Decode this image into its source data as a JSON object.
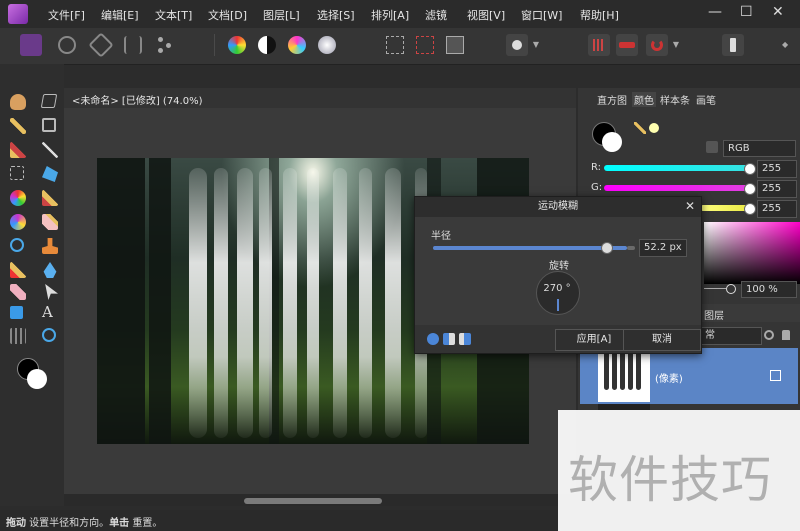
{
  "menu": {
    "items": [
      "文件[F]",
      "编辑[E]",
      "文本[T]",
      "文档[D]",
      "图层[L]",
      "选择[S]",
      "排列[A]",
      "滤镜",
      "视图[V]",
      "窗口[W]",
      "帮助[H]"
    ],
    "minimize": "—",
    "maximize": "☐",
    "close": "✕"
  },
  "document": {
    "title": "<未命名> [已修改] (74.0%)"
  },
  "panels": {
    "tabs": [
      "直方图",
      "颜色",
      "样本条",
      "画笔"
    ],
    "active_tab": "颜色",
    "color_model": "RGB",
    "channels": [
      {
        "label": "R:",
        "value": "255",
        "color": "#38e0e0"
      },
      {
        "label": "G:",
        "value": "255",
        "color": "#e040e0"
      },
      {
        "label": "",
        "value": "255",
        "color": "#e8e840"
      }
    ],
    "opacity": "100 %",
    "layers_tab": "图层",
    "blend_mode": "常",
    "layer_name": "(像素)"
  },
  "dialog": {
    "title": "运动模糊",
    "radius_label": "半径",
    "radius_value": "52.2 px",
    "radius_fraction": 0.87,
    "rotation_label": "旋转",
    "rotation_value": "270 °",
    "apply_label": "应用[A]",
    "cancel_label": "取消"
  },
  "status": {
    "bold1": "拖动",
    "text1": " 设置半径和方向。",
    "bold2": "单击",
    "text2": " 重置。"
  },
  "watermark": {
    "text": "软件技巧"
  }
}
